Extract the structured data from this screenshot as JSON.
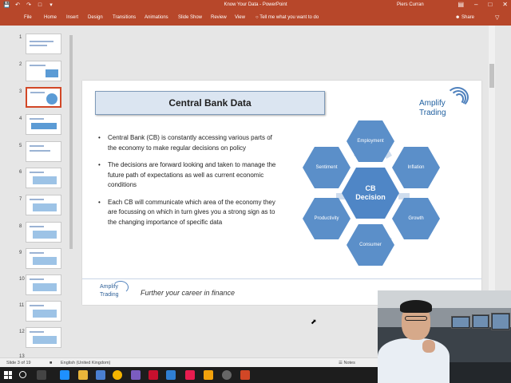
{
  "window": {
    "title": "Know Your Data - PowerPoint",
    "user": "Piers Curran"
  },
  "ribbon": {
    "tabs": [
      "File",
      "Home",
      "Insert",
      "Design",
      "Transitions",
      "Animations",
      "Slide Show",
      "Review",
      "View"
    ],
    "tell_me": "Tell me what you want to do",
    "share": "Share"
  },
  "thumbnails": {
    "numbers": [
      "1",
      "2",
      "3",
      "4",
      "5",
      "6",
      "7",
      "8",
      "9",
      "10",
      "11",
      "12",
      "13"
    ],
    "active": "3"
  },
  "slide": {
    "title": "Central Bank Data",
    "logo_line1": "Amplify",
    "logo_line2": "Trading",
    "bullets": [
      "Central Bank (CB) is constantly accessing various parts of the economy to make regular decisions on policy",
      "The decisions are forward looking and taken to manage the future path of expectations as well as current economic conditions",
      "Each CB will communicate which area of the economy they are focussing on which in turn gives you a strong sign as to the changing importance of specific data"
    ],
    "diagram": {
      "center_line1": "CB",
      "center_line2": "Decision",
      "employment": "Employment",
      "sentiment": "Sentiment",
      "inflation": "Inflation",
      "productivity": "Productivity",
      "growth": "Growth",
      "consumer": "Consumer"
    },
    "footer_logo_line1": "Amplify",
    "footer_logo_line2": "Trading",
    "tagline": "Further your career in finance"
  },
  "status": {
    "slide_counter": "Slide 3 of 19",
    "language": "English (United Kingdom)",
    "notes": "Notes"
  },
  "colors": {
    "ribbon": "#b7472a",
    "hexagon": "#5b8fc9",
    "title_box": "#dbe5f1"
  }
}
